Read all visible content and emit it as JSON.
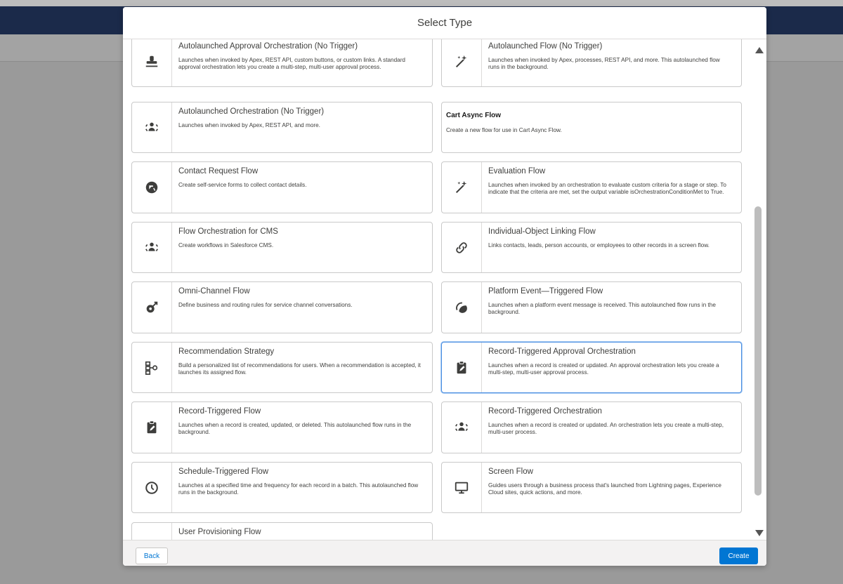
{
  "modal": {
    "title": "Select Type",
    "back_label": "Back",
    "create_label": "Create"
  },
  "tiles": [
    {
      "title": "Autolaunched Approval Orchestration (No Trigger)",
      "desc": "Launches when invoked by Apex, REST API, custom buttons, or custom links. A standard approval orchestration lets you create a multi-step, multi-user approval process.",
      "icon": "stamp-icon"
    },
    {
      "title": "Autolaunched Flow (No Trigger)",
      "desc": "Launches when invoked by Apex, processes, REST API, and more. This autolaunched flow runs in the background.",
      "icon": "magic-wand-icon"
    },
    {
      "title": "Autolaunched Orchestration (No Trigger)",
      "desc": "Launches when invoked by Apex, REST API, and more.",
      "icon": "orchestration-icon"
    },
    {
      "title": "Cart Async Flow",
      "desc": "Create a new flow for use in Cart Async Flow.",
      "icon": ""
    },
    {
      "title": "Contact Request Flow",
      "desc": "Create self-service forms to collect contact details.",
      "icon": "contact-request-icon"
    },
    {
      "title": "Evaluation Flow",
      "desc": "Launches when invoked by an orchestration to evaluate custom criteria for a stage or step. To indicate that the criteria are met, set the output variable isOrchestrationConditionMet to True.",
      "icon": "magic-wand-icon"
    },
    {
      "title": "Flow Orchestration for CMS",
      "desc": "Create workflows in Salesforce CMS.",
      "icon": "orchestration-icon"
    },
    {
      "title": "Individual-Object Linking Flow",
      "desc": "Links contacts, leads, person accounts, or employees to other records in a screen flow.",
      "icon": "link-icon"
    },
    {
      "title": "Omni-Channel Flow",
      "desc": "Define business and routing rules for service channel conversations.",
      "icon": "omni-channel-icon"
    },
    {
      "title": "Platform Event—Triggered Flow",
      "desc": "Launches when a platform event message is received. This autolaunched flow runs in the background.",
      "icon": "platform-event-icon"
    },
    {
      "title": "Recommendation Strategy",
      "desc": "Build a personalized list of recommendations for users. When a recommendation is accepted, it launches its assigned flow.",
      "icon": "strategy-icon"
    },
    {
      "title": "Record-Triggered Approval Orchestration",
      "desc": "Launches when a record is created or updated. An approval orchestration lets you create a multi-step, multi-user approval process.",
      "icon": "record-edit-icon"
    },
    {
      "title": "Record-Triggered Flow",
      "desc": "Launches when a record is created, updated, or deleted. This autolaunched flow runs in the background.",
      "icon": "record-edit-icon"
    },
    {
      "title": "Record-Triggered Orchestration",
      "desc": "Launches when a record is created or updated. An orchestration lets you create a multi-step, multi-user process.",
      "icon": "orchestration-icon"
    },
    {
      "title": "Schedule-Triggered Flow",
      "desc": "Launches at a specified time and frequency for each record in a batch. This autolaunched flow runs in the background.",
      "icon": "clock-icon"
    },
    {
      "title": "Screen Flow",
      "desc": "Guides users through a business process that's launched from Lightning pages, Experience Cloud sites, quick actions, and more.",
      "icon": "monitor-icon"
    },
    {
      "title": "User Provisioning Flow",
      "desc": "",
      "icon": "user-icon"
    }
  ]
}
